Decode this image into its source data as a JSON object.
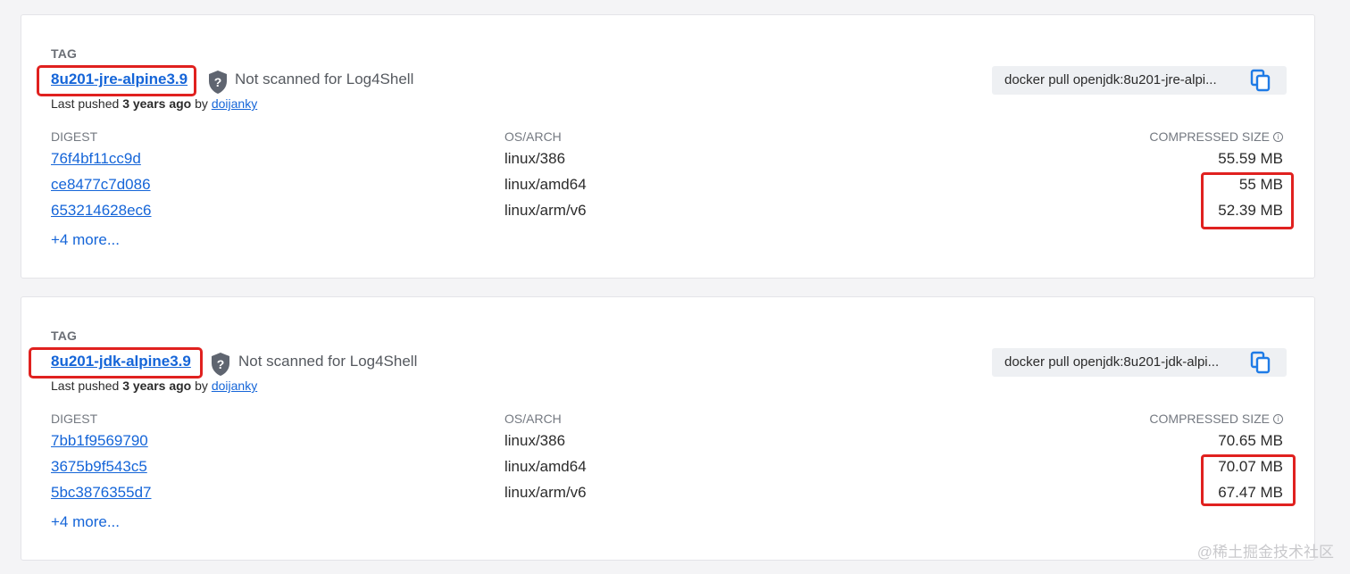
{
  "tags": [
    {
      "caption": "TAG",
      "name": "8u201-jre-alpine3.9",
      "scan_status": "Not scanned for Log4Shell",
      "last_pushed_prefix": "Last pushed",
      "last_pushed_time": "3 years ago",
      "by": "by",
      "pusher": "doijanky",
      "pull_command": "docker pull openjdk:8u201-jre-alpi...",
      "columns": {
        "digest": "DIGEST",
        "os_arch": "OS/ARCH",
        "size": "COMPRESSED SIZE"
      },
      "rows": [
        {
          "digest": "76f4bf11cc9d",
          "os_arch": "linux/386",
          "size": "55.59 MB"
        },
        {
          "digest": "ce8477c7d086",
          "os_arch": "linux/amd64",
          "size": "55 MB"
        },
        {
          "digest": "653214628ec6",
          "os_arch": "linux/arm/v6",
          "size": "52.39 MB"
        }
      ],
      "more": "+4 more..."
    },
    {
      "caption": "TAG",
      "name": "8u201-jdk-alpine3.9",
      "scan_status": "Not scanned for Log4Shell",
      "last_pushed_prefix": "Last pushed",
      "last_pushed_time": "3 years ago",
      "by": "by",
      "pusher": "doijanky",
      "pull_command": "docker pull openjdk:8u201-jdk-alpi...",
      "columns": {
        "digest": "DIGEST",
        "os_arch": "OS/ARCH",
        "size": "COMPRESSED SIZE"
      },
      "rows": [
        {
          "digest": "7bb1f9569790",
          "os_arch": "linux/386",
          "size": "70.65 MB"
        },
        {
          "digest": "3675b9f543c5",
          "os_arch": "linux/amd64",
          "size": "70.07 MB"
        },
        {
          "digest": "5bc3876355d7",
          "os_arch": "linux/arm/v6",
          "size": "67.47 MB"
        }
      ],
      "more": "+4 more..."
    }
  ],
  "icons": {
    "scan": "shield-question-icon",
    "copy": "copy-icon",
    "info": "info-icon"
  },
  "colors": {
    "link": "#1565d8",
    "highlight": "#e0211f",
    "shield": "#5f6570",
    "copy": "#1e7be6"
  },
  "watermark": "@稀土掘金技术社区"
}
